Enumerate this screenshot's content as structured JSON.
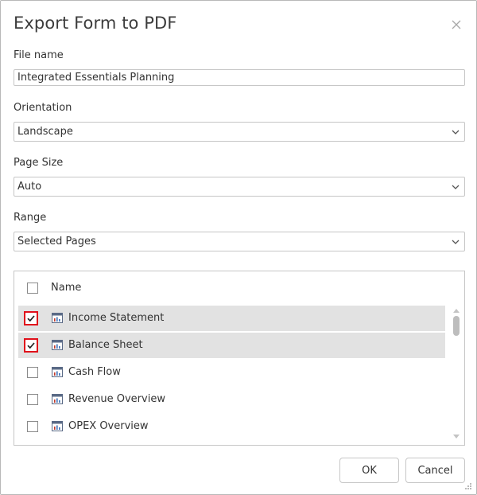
{
  "dialog": {
    "title": "Export Form to PDF",
    "close_icon": "close-icon"
  },
  "file_name": {
    "label": "File name",
    "value": "Integrated Essentials Planning"
  },
  "orientation": {
    "label": "Orientation",
    "value": "Landscape"
  },
  "page_size": {
    "label": "Page Size",
    "value": "Auto"
  },
  "range": {
    "label": "Range",
    "value": "Selected Pages"
  },
  "pages_list": {
    "header_label": "Name",
    "header_checked": false,
    "rows": [
      {
        "label": "Income Statement",
        "checked": true,
        "selected": true,
        "icon": "report-icon"
      },
      {
        "label": "Balance Sheet",
        "checked": true,
        "selected": true,
        "icon": "report-icon"
      },
      {
        "label": "Cash Flow",
        "checked": false,
        "selected": false,
        "icon": "report-icon"
      },
      {
        "label": "Revenue Overview",
        "checked": false,
        "selected": false,
        "icon": "report-icon"
      },
      {
        "label": "OPEX Overview",
        "checked": false,
        "selected": false,
        "icon": "report-icon"
      }
    ]
  },
  "buttons": {
    "ok": "OK",
    "cancel": "Cancel"
  },
  "colors": {
    "check_highlight": "#e0101b",
    "selected_row": "#e2e2e2",
    "border": "#c6c6c6"
  }
}
